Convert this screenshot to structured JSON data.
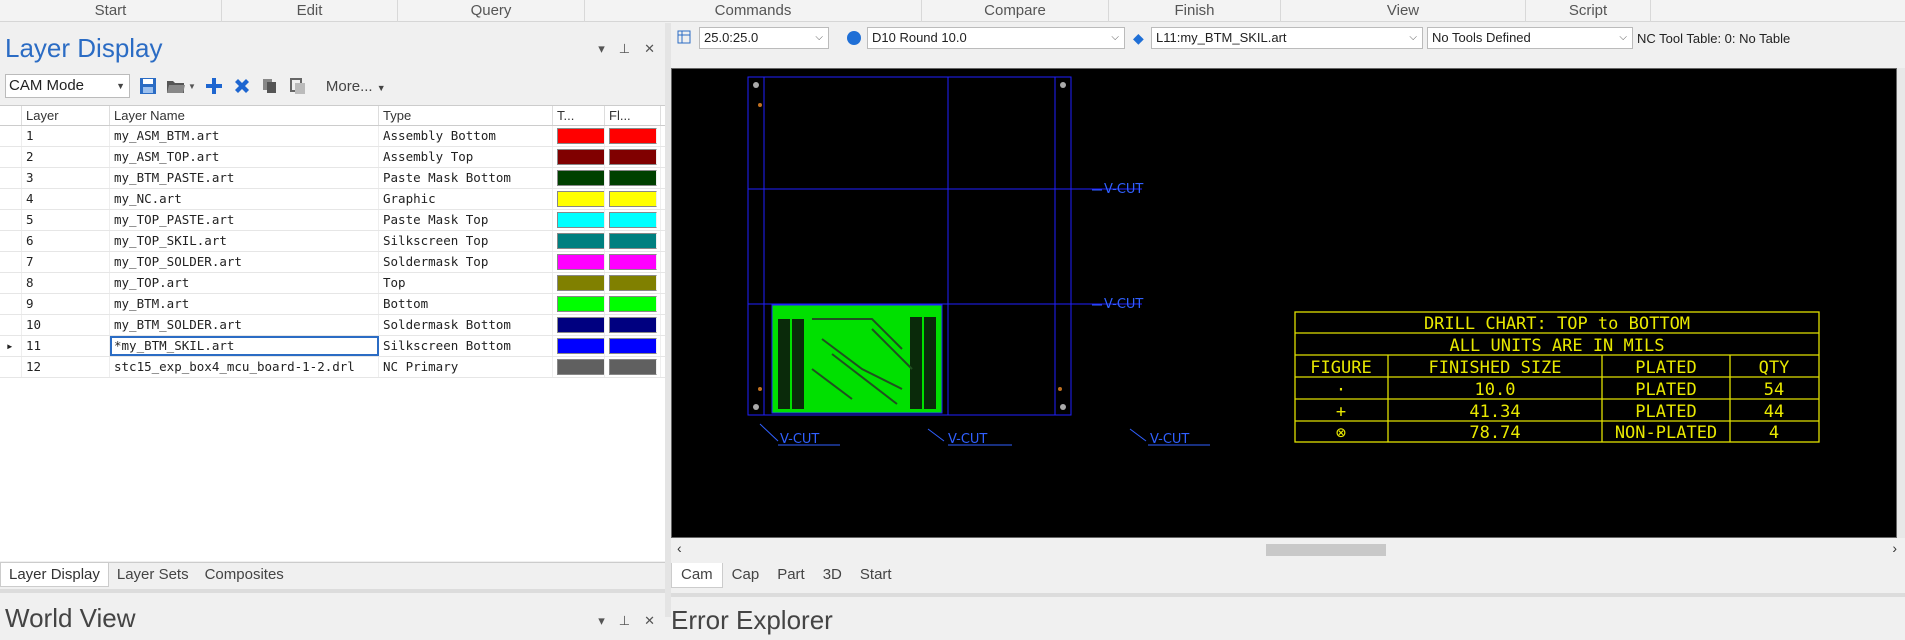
{
  "menu": [
    "Start",
    "Edit",
    "Query",
    "Commands",
    "Compare",
    "Finish",
    "View",
    "Script"
  ],
  "layer_display": {
    "title": "Layer Display",
    "mode": "CAM Mode",
    "more_label": "More...",
    "columns": [
      "Layer",
      "Layer Name",
      "Type",
      "T...",
      "Fl..."
    ],
    "rows": [
      {
        "num": "1",
        "name": "my_ASM_BTM.art",
        "type": "Assembly Bottom",
        "color": "#ff0000"
      },
      {
        "num": "2",
        "name": "my_ASM_TOP.art",
        "type": "Assembly Top",
        "color": "#800000"
      },
      {
        "num": "3",
        "name": "my_BTM_PASTE.art",
        "type": "Paste Mask Bottom",
        "color": "#004000"
      },
      {
        "num": "4",
        "name": "my_NC.art",
        "type": "Graphic",
        "color": "#ffff00"
      },
      {
        "num": "5",
        "name": "my_TOP_PASTE.art",
        "type": "Paste Mask Top",
        "color": "#00ffff"
      },
      {
        "num": "6",
        "name": "my_TOP_SKIL.art",
        "type": "Silkscreen Top",
        "color": "#008080"
      },
      {
        "num": "7",
        "name": "my_TOP_SOLDER.art",
        "type": "Soldermask Top",
        "color": "#ff00ff"
      },
      {
        "num": "8",
        "name": "my_TOP.art",
        "type": "Top",
        "color": "#808000"
      },
      {
        "num": "9",
        "name": "my_BTM.art",
        "type": "Bottom",
        "color": "#00ff00"
      },
      {
        "num": "10",
        "name": "my_BTM_SOLDER.art",
        "type": "Soldermask Bottom",
        "color": "#000080"
      },
      {
        "num": "11",
        "name": "*my_BTM_SKIL.art",
        "type": "Silkscreen Bottom",
        "color": "#0000ff",
        "selected": true
      },
      {
        "num": "12",
        "name": "stc15_exp_box4_mcu_board-1-2.drl",
        "type": "NC Primary",
        "color": "#606060"
      }
    ],
    "tabs": [
      "Layer Display",
      "Layer Sets",
      "Composites"
    ]
  },
  "world_view": {
    "title": "World View"
  },
  "toolbar_right": {
    "grid": "25.0:25.0",
    "dcode": "D10  Round 10.0",
    "layer": "L11:my_BTM_SKIL.art",
    "tools": "No Tools Defined",
    "nc_table": "NC Tool Table: 0: No Table"
  },
  "canvas": {
    "vcut_label": "V-CUT",
    "drill_chart": {
      "title": "DRILL CHART: TOP to BOTTOM",
      "subtitle": "ALL UNITS ARE IN MILS",
      "headers": [
        "FIGURE",
        "FINISHED_SIZE",
        "PLATED",
        "QTY"
      ],
      "rows": [
        {
          "figure": "·",
          "size": "10.0",
          "plated": "PLATED",
          "qty": "54"
        },
        {
          "figure": "+",
          "size": "41.34",
          "plated": "PLATED",
          "qty": "44"
        },
        {
          "figure": "⊗",
          "size": "78.74",
          "plated": "NON-PLATED",
          "qty": "4"
        }
      ]
    }
  },
  "view_tabs": [
    "Cam",
    "Cap",
    "Part",
    "3D",
    "Start"
  ],
  "error_explorer": {
    "title": "Error Explorer"
  }
}
